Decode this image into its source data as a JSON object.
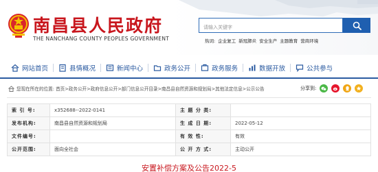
{
  "header": {
    "title": "南昌县人民政府",
    "subtitle": "THE NANCHANG COUNTY PEOPLES GOVERNMENT",
    "search_placeholder": "请输入关键字",
    "hot_label": "热词:",
    "hot_words": [
      "企业复工",
      "新冠肺炎",
      "安全生产",
      "主题教育",
      "营商环境"
    ]
  },
  "nav": {
    "items": [
      {
        "label": "网站首页",
        "icon": "home-icon"
      },
      {
        "label": "县情概况",
        "icon": "building-icon"
      },
      {
        "label": "新闻中心",
        "icon": "news-icon"
      },
      {
        "label": "政务公开",
        "icon": "folder-icon"
      },
      {
        "label": "政务服务",
        "icon": "service-icon"
      },
      {
        "label": "数据开放",
        "icon": "data-icon"
      },
      {
        "label": "公共参与",
        "icon": "chat-icon"
      }
    ]
  },
  "breadcrumb": {
    "text": "您现在所在的位置: 首页>政务公开>政府信息公开>部门信息公开目录>南昌县自然资源和规划局>其他法定信息>公示公告",
    "share_label": "分享到:",
    "share_icons": [
      "wechat-icon",
      "weibo-icon",
      "qq-icon",
      "qzone-icon"
    ]
  },
  "meta": {
    "rows": [
      {
        "k1": "索 引 号:",
        "v1": "x352688--2022-0141",
        "k2": "主 题 分 类:",
        "v2": ""
      },
      {
        "k1": "发布机构:",
        "v1": "南昌县自然资源和规划局",
        "k2": "生 成 日 期:",
        "v2": "2022-05-12"
      },
      {
        "k1": "文件编号:",
        "v1": "",
        "k2": "有 效 性:",
        "v2": "有效"
      },
      {
        "k1": "公开范围:",
        "v1": "面向全社会",
        "k2": "公 开 方 式:",
        "v2": "主动公开"
      }
    ]
  },
  "document": {
    "title": "安置补偿方案及公告2022-5"
  },
  "colors": {
    "brand_red": "#c8161d",
    "nav_blue": "#2a5aa0",
    "search_blue": "#1f5fb0"
  }
}
